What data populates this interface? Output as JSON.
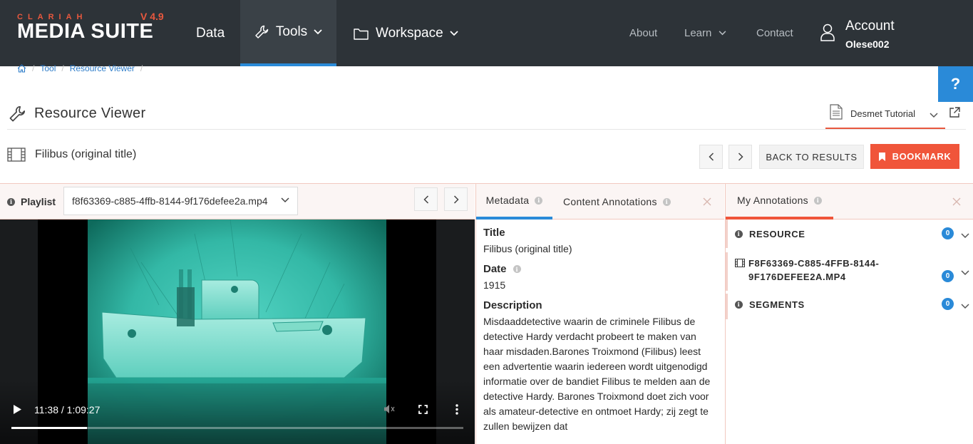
{
  "brand": {
    "small": "CLARIAH",
    "big": "MEDIA SUITE",
    "version": "V 4.9",
    "accent": "#e8583e"
  },
  "nav": {
    "data": "Data",
    "tools": "Tools",
    "workspace": "Workspace",
    "about": "About",
    "learn": "Learn",
    "contact": "Contact",
    "account": "Account",
    "username": "Olese002"
  },
  "help": {
    "label": "?"
  },
  "breadcrumb": {
    "tool": "Tool",
    "page": "Resource Viewer"
  },
  "tool": {
    "title": "Resource Viewer"
  },
  "project": {
    "name": "Desmet Tutorial"
  },
  "resource": {
    "title": "Filibus (original title)",
    "back_label": "BACK TO RESULTS",
    "bookmark_label": "BOOKMARK"
  },
  "playlist": {
    "label": "Playlist",
    "selected": "f8f63369-c885-4ffb-8144-9f176defee2a.mp4"
  },
  "player": {
    "time": "11:38 / 1:09:27",
    "progress_fraction": 0.1675
  },
  "tabs": {
    "metadata": "Metadata",
    "content_annotations": "Content Annotations",
    "my_annotations": "My Annotations"
  },
  "metadata": {
    "title_label": "Title",
    "title_value": "Filibus (original title)",
    "date_label": "Date",
    "date_value": "1915",
    "description_label": "Description",
    "description_value": "Misdaaddetective waarin de criminele Filibus de detective Hardy verdacht probeert te maken van haar misdaden.Barones Troixmond (Filibus) leest een advertentie waarin iedereen wordt uitgenodigd informatie over de bandiet Filibus te melden aan de detective Hardy. Barones Troixmond doet zich voor als amateur-detective en ontmoet Hardy; zij zegt te zullen bewijzen dat"
  },
  "annotations": {
    "resource_label": "RESOURCE",
    "resource_count": "0",
    "file_label": "F8F63369-C885-4FFB-8144-9F176DEFEE2A.MP4",
    "file_count": "0",
    "segments_label": "SEGMENTS",
    "segments_count": "0"
  }
}
